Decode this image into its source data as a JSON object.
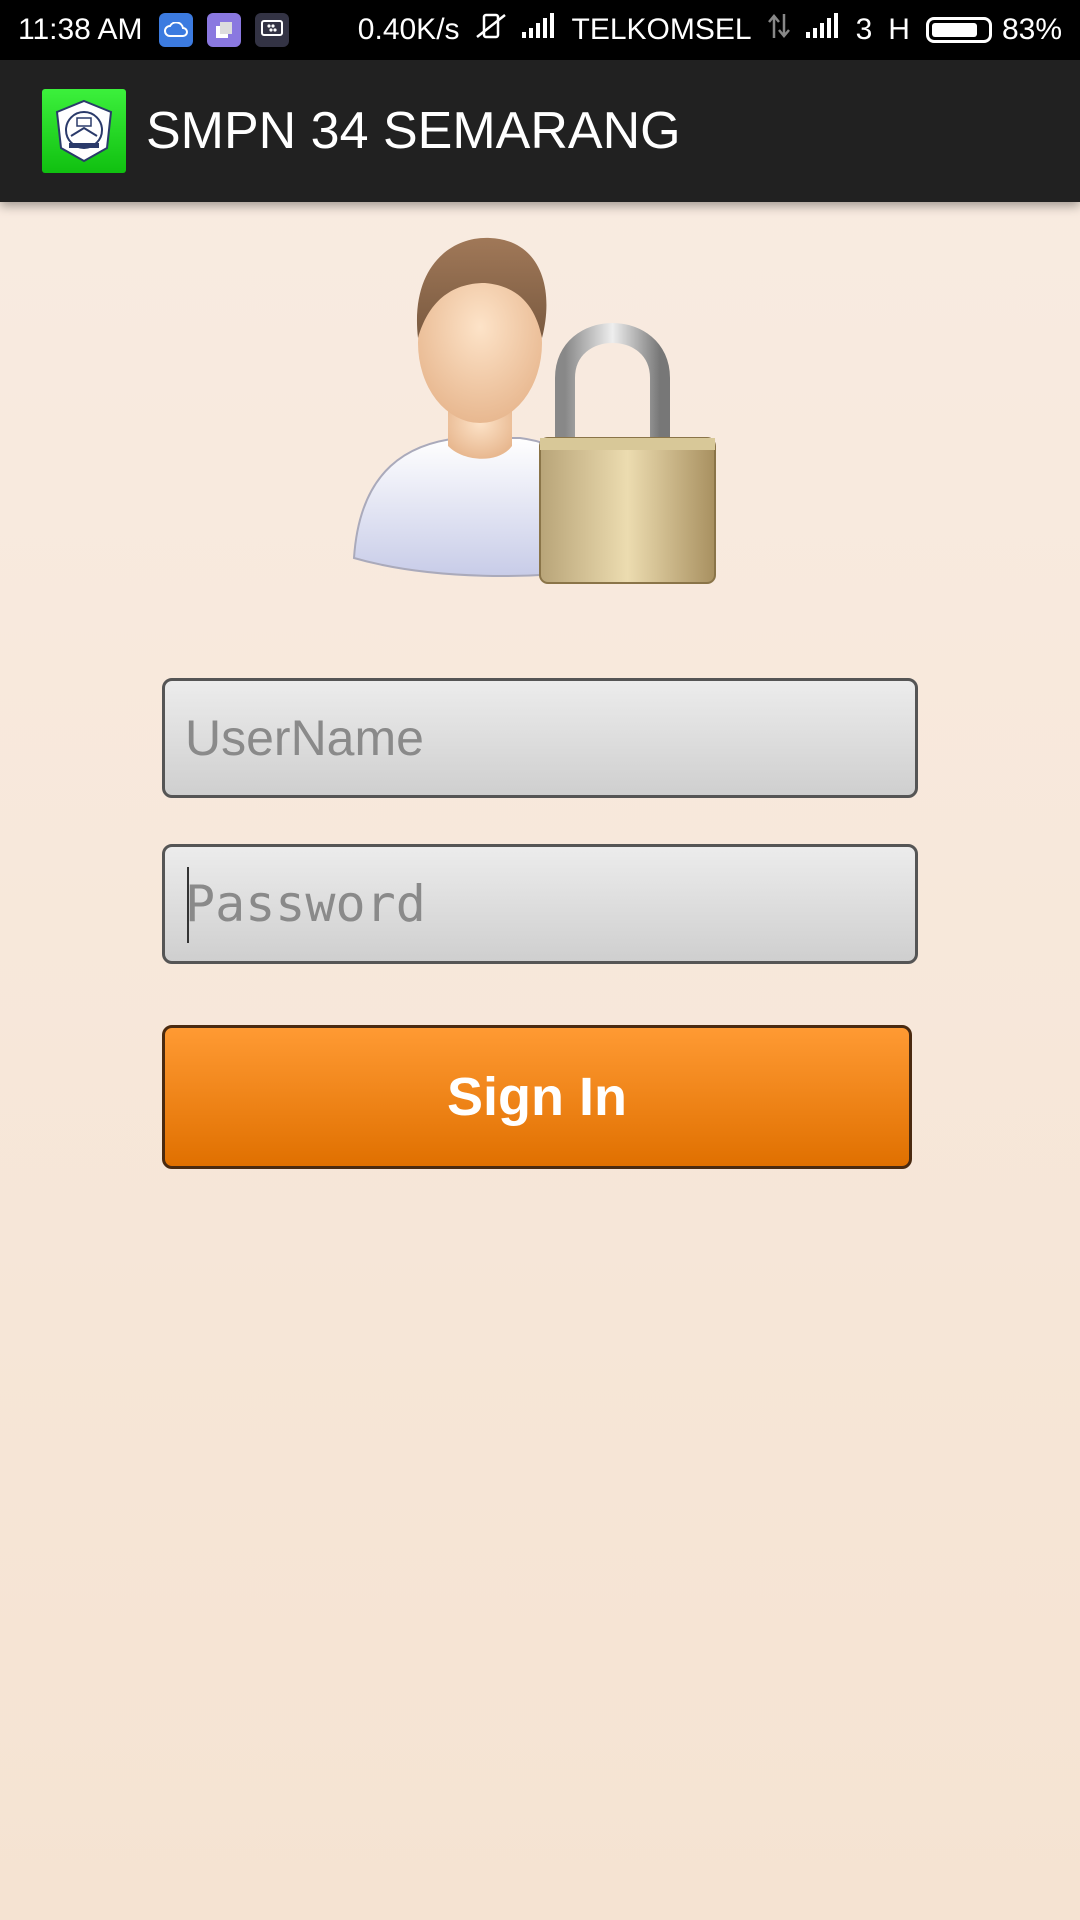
{
  "status_bar": {
    "time": "11:38 AM",
    "speed": "0.40K/s",
    "carrier": "TELKOMSEL",
    "network_digit": "3",
    "network_type": "H",
    "battery_percent": "83%",
    "battery_level": 0.83
  },
  "app_bar": {
    "title": "SMPN 34 SEMARANG"
  },
  "login": {
    "username_placeholder": "UserName",
    "password_placeholder": "Password",
    "signin_label": "Sign In"
  },
  "colors": {
    "button": "#f08a1e",
    "background": "#f7e8dc",
    "appbar": "#212121"
  }
}
